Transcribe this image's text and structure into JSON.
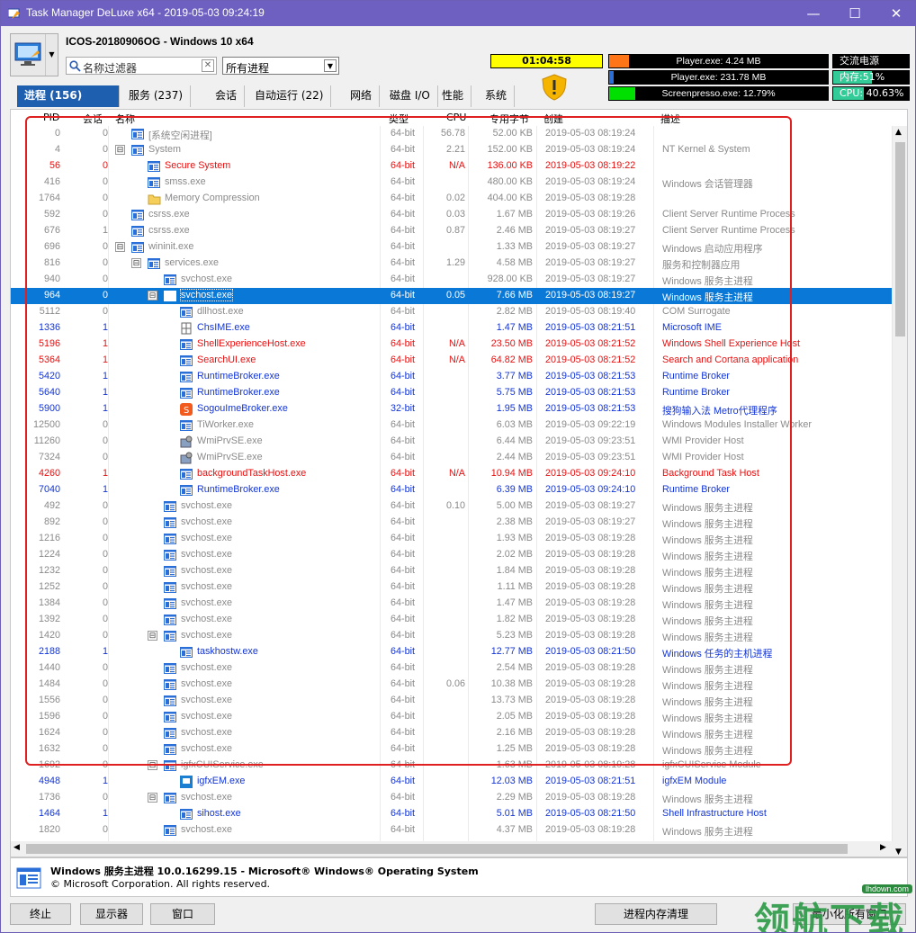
{
  "window": {
    "title": "Task Manager DeLuxe x64 - 2019-05-03 09:24:19"
  },
  "header": {
    "hostname": "ICOS-20180906OG - Windows 10 x64",
    "filter_placeholder": "名称过滤器",
    "process_filter": "所有进程",
    "clock": "01:04:58",
    "bars": [
      {
        "label": "Player.exe: 4.24 MB",
        "fill": 0.09,
        "color": "#ff7518"
      },
      {
        "label": "Player.exe: 231.78 MB",
        "fill": 0.02,
        "color": "#2a6ed8"
      },
      {
        "label": "Screenpresso.exe: 12.79%",
        "fill": 0.12,
        "color": "#00e000"
      }
    ],
    "status": [
      {
        "label": "交流电源",
        "fill": 0
      },
      {
        "label": "内存:51%",
        "fill": 0.51
      },
      {
        "label": "CPU: 40.63%",
        "fill": 0.4
      }
    ]
  },
  "tabs": [
    "进程 (156)",
    "服务 (237)",
    "会话",
    "自动运行 (22)",
    "网络",
    "磁盘 I/O",
    "性能",
    "系统"
  ],
  "columns": {
    "pid": "PID",
    "session": "会话",
    "name": "名称",
    "type": "类型",
    "cpu": "CPU",
    "mem": "专用字节",
    "created": "创建",
    "desc": "描述"
  },
  "rows": [
    {
      "pid": "0",
      "s": "0",
      "d": 1,
      "t": "",
      "n": "[系统空闲进程]",
      "ty": "64-bit",
      "c": "56.78",
      "m": "52.00 KB",
      "cr": "2019-05-03 08:19:24",
      "ds": "",
      "st": "gray",
      "ic": "win"
    },
    {
      "pid": "4",
      "s": "0",
      "d": 1,
      "t": "⊟",
      "n": "System",
      "ty": "64-bit",
      "c": "2.21",
      "m": "152.00 KB",
      "cr": "2019-05-03 08:19:24",
      "ds": "NT Kernel & System",
      "st": "gray",
      "ic": "win"
    },
    {
      "pid": "56",
      "s": "0",
      "d": 2,
      "t": "",
      "n": "Secure System",
      "ty": "64-bit",
      "c": "N/A",
      "m": "136.00 KB",
      "cr": "2019-05-03 08:19:22",
      "ds": "",
      "st": "red",
      "ic": "win"
    },
    {
      "pid": "416",
      "s": "0",
      "d": 2,
      "t": "",
      "n": "smss.exe",
      "ty": "64-bit",
      "c": "",
      "m": "480.00 KB",
      "cr": "2019-05-03 08:19:24",
      "ds": "Windows 会话管理器",
      "st": "gray",
      "ic": "win"
    },
    {
      "pid": "1764",
      "s": "0",
      "d": 2,
      "t": "",
      "n": "Memory Compression",
      "ty": "64-bit",
      "c": "0.02",
      "m": "404.00 KB",
      "cr": "2019-05-03 08:19:28",
      "ds": "",
      "st": "gray",
      "ic": "folder"
    },
    {
      "pid": "592",
      "s": "0",
      "d": 1,
      "t": "",
      "n": "csrss.exe",
      "ty": "64-bit",
      "c": "0.03",
      "m": "1.67 MB",
      "cr": "2019-05-03 08:19:26",
      "ds": "Client Server Runtime Process",
      "st": "gray",
      "ic": "win"
    },
    {
      "pid": "676",
      "s": "1",
      "d": 1,
      "t": "",
      "n": "csrss.exe",
      "ty": "64-bit",
      "c": "0.87",
      "m": "2.46 MB",
      "cr": "2019-05-03 08:19:27",
      "ds": "Client Server Runtime Process",
      "st": "gray",
      "ic": "win"
    },
    {
      "pid": "696",
      "s": "0",
      "d": 1,
      "t": "⊟",
      "n": "wininit.exe",
      "ty": "64-bit",
      "c": "",
      "m": "1.33 MB",
      "cr": "2019-05-03 08:19:27",
      "ds": "Windows 启动应用程序",
      "st": "gray",
      "ic": "win"
    },
    {
      "pid": "816",
      "s": "0",
      "d": 2,
      "t": "⊟",
      "n": "services.exe",
      "ty": "64-bit",
      "c": "1.29",
      "m": "4.58 MB",
      "cr": "2019-05-03 08:19:27",
      "ds": "服务和控制器应用",
      "st": "gray",
      "ic": "win"
    },
    {
      "pid": "940",
      "s": "0",
      "d": 3,
      "t": "",
      "n": "svchost.exe",
      "ty": "64-bit",
      "c": "",
      "m": "928.00 KB",
      "cr": "2019-05-03 08:19:27",
      "ds": "Windows 服务主进程",
      "st": "gray",
      "ic": "win"
    },
    {
      "pid": "964",
      "s": "0",
      "d": 3,
      "t": "⊟",
      "n": "svchost.exe",
      "ty": "64-bit",
      "c": "0.05",
      "m": "7.66 MB",
      "cr": "2019-05-03 08:19:27",
      "ds": "Windows 服务主进程",
      "st": "selrow",
      "ic": "win"
    },
    {
      "pid": "5112",
      "s": "0",
      "d": 4,
      "t": "",
      "n": "dllhost.exe",
      "ty": "64-bit",
      "c": "",
      "m": "2.82 MB",
      "cr": "2019-05-03 08:19:40",
      "ds": "COM Surrogate",
      "st": "gray",
      "ic": "win"
    },
    {
      "pid": "1336",
      "s": "1",
      "d": 4,
      "t": "",
      "n": "ChsIME.exe",
      "ty": "64-bit",
      "c": "",
      "m": "1.47 MB",
      "cr": "2019-05-03 08:21:51",
      "ds": "Microsoft IME",
      "st": "blue",
      "ic": "ime"
    },
    {
      "pid": "5196",
      "s": "1",
      "d": 4,
      "t": "",
      "n": "ShellExperienceHost.exe",
      "ty": "64-bit",
      "c": "N/A",
      "m": "23.50 MB",
      "cr": "2019-05-03 08:21:52",
      "ds": "Windows Shell Experience Host",
      "st": "red",
      "ic": "win"
    },
    {
      "pid": "5364",
      "s": "1",
      "d": 4,
      "t": "",
      "n": "SearchUI.exe",
      "ty": "64-bit",
      "c": "N/A",
      "m": "64.82 MB",
      "cr": "2019-05-03 08:21:52",
      "ds": "Search and Cortana application",
      "st": "red",
      "ic": "win"
    },
    {
      "pid": "5420",
      "s": "1",
      "d": 4,
      "t": "",
      "n": "RuntimeBroker.exe",
      "ty": "64-bit",
      "c": "",
      "m": "3.77 MB",
      "cr": "2019-05-03 08:21:53",
      "ds": "Runtime Broker",
      "st": "blue",
      "ic": "win"
    },
    {
      "pid": "5640",
      "s": "1",
      "d": 4,
      "t": "",
      "n": "RuntimeBroker.exe",
      "ty": "64-bit",
      "c": "",
      "m": "5.75 MB",
      "cr": "2019-05-03 08:21:53",
      "ds": "Runtime Broker",
      "st": "blue",
      "ic": "win"
    },
    {
      "pid": "5900",
      "s": "1",
      "d": 4,
      "t": "",
      "n": "SogouImeBroker.exe",
      "ty": "32-bit",
      "c": "",
      "m": "1.95 MB",
      "cr": "2019-05-03 08:21:53",
      "ds": "搜狗输入法 Metro代理程序",
      "st": "blue",
      "ic": "sogou"
    },
    {
      "pid": "12500",
      "s": "0",
      "d": 4,
      "t": "",
      "n": "TiWorker.exe",
      "ty": "64-bit",
      "c": "",
      "m": "6.03 MB",
      "cr": "2019-05-03 09:22:19",
      "ds": "Windows Modules Installer Worker",
      "st": "gray",
      "ic": "win"
    },
    {
      "pid": "11260",
      "s": "0",
      "d": 4,
      "t": "",
      "n": "WmiPrvSE.exe",
      "ty": "64-bit",
      "c": "",
      "m": "6.44 MB",
      "cr": "2019-05-03 09:23:51",
      "ds": "WMI Provider Host",
      "st": "gray",
      "ic": "wmi"
    },
    {
      "pid": "7324",
      "s": "0",
      "d": 4,
      "t": "",
      "n": "WmiPrvSE.exe",
      "ty": "64-bit",
      "c": "",
      "m": "2.44 MB",
      "cr": "2019-05-03 09:23:51",
      "ds": "WMI Provider Host",
      "st": "gray",
      "ic": "wmi"
    },
    {
      "pid": "4260",
      "s": "1",
      "d": 4,
      "t": "",
      "n": "backgroundTaskHost.exe",
      "ty": "64-bit",
      "c": "N/A",
      "m": "10.94 MB",
      "cr": "2019-05-03 09:24:10",
      "ds": "Background Task Host",
      "st": "red",
      "ic": "win"
    },
    {
      "pid": "7040",
      "s": "1",
      "d": 4,
      "t": "",
      "n": "RuntimeBroker.exe",
      "ty": "64-bit",
      "c": "",
      "m": "6.39 MB",
      "cr": "2019-05-03 09:24:10",
      "ds": "Runtime Broker",
      "st": "blue",
      "ic": "win"
    },
    {
      "pid": "492",
      "s": "0",
      "d": 3,
      "t": "",
      "n": "svchost.exe",
      "ty": "64-bit",
      "c": "0.10",
      "m": "5.00 MB",
      "cr": "2019-05-03 08:19:27",
      "ds": "Windows 服务主进程",
      "st": "gray",
      "ic": "win"
    },
    {
      "pid": "892",
      "s": "0",
      "d": 3,
      "t": "",
      "n": "svchost.exe",
      "ty": "64-bit",
      "c": "",
      "m": "2.38 MB",
      "cr": "2019-05-03 08:19:27",
      "ds": "Windows 服务主进程",
      "st": "gray",
      "ic": "win"
    },
    {
      "pid": "1216",
      "s": "0",
      "d": 3,
      "t": "",
      "n": "svchost.exe",
      "ty": "64-bit",
      "c": "",
      "m": "1.93 MB",
      "cr": "2019-05-03 08:19:28",
      "ds": "Windows 服务主进程",
      "st": "gray",
      "ic": "win"
    },
    {
      "pid": "1224",
      "s": "0",
      "d": 3,
      "t": "",
      "n": "svchost.exe",
      "ty": "64-bit",
      "c": "",
      "m": "2.02 MB",
      "cr": "2019-05-03 08:19:28",
      "ds": "Windows 服务主进程",
      "st": "gray",
      "ic": "win"
    },
    {
      "pid": "1232",
      "s": "0",
      "d": 3,
      "t": "",
      "n": "svchost.exe",
      "ty": "64-bit",
      "c": "",
      "m": "1.84 MB",
      "cr": "2019-05-03 08:19:28",
      "ds": "Windows 服务主进程",
      "st": "gray",
      "ic": "win"
    },
    {
      "pid": "1252",
      "s": "0",
      "d": 3,
      "t": "",
      "n": "svchost.exe",
      "ty": "64-bit",
      "c": "",
      "m": "1.11 MB",
      "cr": "2019-05-03 08:19:28",
      "ds": "Windows 服务主进程",
      "st": "gray",
      "ic": "win"
    },
    {
      "pid": "1384",
      "s": "0",
      "d": 3,
      "t": "",
      "n": "svchost.exe",
      "ty": "64-bit",
      "c": "",
      "m": "1.47 MB",
      "cr": "2019-05-03 08:19:28",
      "ds": "Windows 服务主进程",
      "st": "gray",
      "ic": "win"
    },
    {
      "pid": "1392",
      "s": "0",
      "d": 3,
      "t": "",
      "n": "svchost.exe",
      "ty": "64-bit",
      "c": "",
      "m": "1.82 MB",
      "cr": "2019-05-03 08:19:28",
      "ds": "Windows 服务主进程",
      "st": "gray",
      "ic": "win"
    },
    {
      "pid": "1420",
      "s": "0",
      "d": 3,
      "t": "⊟",
      "n": "svchost.exe",
      "ty": "64-bit",
      "c": "",
      "m": "5.23 MB",
      "cr": "2019-05-03 08:19:28",
      "ds": "Windows 服务主进程",
      "st": "gray",
      "ic": "win"
    },
    {
      "pid": "2188",
      "s": "1",
      "d": 4,
      "t": "",
      "n": "taskhostw.exe",
      "ty": "64-bit",
      "c": "",
      "m": "12.77 MB",
      "cr": "2019-05-03 08:21:50",
      "ds": "Windows 任务的主机进程",
      "st": "blue",
      "ic": "win"
    },
    {
      "pid": "1440",
      "s": "0",
      "d": 3,
      "t": "",
      "n": "svchost.exe",
      "ty": "64-bit",
      "c": "",
      "m": "2.54 MB",
      "cr": "2019-05-03 08:19:28",
      "ds": "Windows 服务主进程",
      "st": "gray",
      "ic": "win"
    },
    {
      "pid": "1484",
      "s": "0",
      "d": 3,
      "t": "",
      "n": "svchost.exe",
      "ty": "64-bit",
      "c": "0.06",
      "m": "10.38 MB",
      "cr": "2019-05-03 08:19:28",
      "ds": "Windows 服务主进程",
      "st": "gray",
      "ic": "win"
    },
    {
      "pid": "1556",
      "s": "0",
      "d": 3,
      "t": "",
      "n": "svchost.exe",
      "ty": "64-bit",
      "c": "",
      "m": "13.73 MB",
      "cr": "2019-05-03 08:19:28",
      "ds": "Windows 服务主进程",
      "st": "gray",
      "ic": "win"
    },
    {
      "pid": "1596",
      "s": "0",
      "d": 3,
      "t": "",
      "n": "svchost.exe",
      "ty": "64-bit",
      "c": "",
      "m": "2.05 MB",
      "cr": "2019-05-03 08:19:28",
      "ds": "Windows 服务主进程",
      "st": "gray",
      "ic": "win"
    },
    {
      "pid": "1624",
      "s": "0",
      "d": 3,
      "t": "",
      "n": "svchost.exe",
      "ty": "64-bit",
      "c": "",
      "m": "2.16 MB",
      "cr": "2019-05-03 08:19:28",
      "ds": "Windows 服务主进程",
      "st": "gray",
      "ic": "win"
    },
    {
      "pid": "1632",
      "s": "0",
      "d": 3,
      "t": "",
      "n": "svchost.exe",
      "ty": "64-bit",
      "c": "",
      "m": "1.25 MB",
      "cr": "2019-05-03 08:19:28",
      "ds": "Windows 服务主进程",
      "st": "gray",
      "ic": "win"
    },
    {
      "pid": "1692",
      "s": "0",
      "d": 3,
      "t": "⊟",
      "n": "igfxCUIService.exe",
      "ty": "64-bit",
      "c": "",
      "m": "1.63 MB",
      "cr": "2019-05-03 08:19:28",
      "ds": "igfxCUIService Module",
      "st": "gray",
      "ic": "win"
    },
    {
      "pid": "4948",
      "s": "1",
      "d": 4,
      "t": "",
      "n": "igfxEM.exe",
      "ty": "64-bit",
      "c": "",
      "m": "12.03 MB",
      "cr": "2019-05-03 08:21:51",
      "ds": "igfxEM Module",
      "st": "blue",
      "ic": "igfx"
    },
    {
      "pid": "1736",
      "s": "0",
      "d": 3,
      "t": "⊟",
      "n": "svchost.exe",
      "ty": "64-bit",
      "c": "",
      "m": "2.29 MB",
      "cr": "2019-05-03 08:19:28",
      "ds": "Windows 服务主进程",
      "st": "gray",
      "ic": "win"
    },
    {
      "pid": "1464",
      "s": "1",
      "d": 4,
      "t": "",
      "n": "sihost.exe",
      "ty": "64-bit",
      "c": "",
      "m": "5.01 MB",
      "cr": "2019-05-03 08:21:50",
      "ds": "Shell Infrastructure Host",
      "st": "blue",
      "ic": "win"
    },
    {
      "pid": "1820",
      "s": "0",
      "d": 3,
      "t": "",
      "n": "svchost.exe",
      "ty": "64-bit",
      "c": "",
      "m": "4.37 MB",
      "cr": "2019-05-03 08:19:28",
      "ds": "Windows 服务主进程",
      "st": "gray",
      "ic": "win"
    }
  ],
  "info": {
    "line1": "Windows 服务主进程 10.0.16299.15 - Microsoft® Windows® Operating System",
    "line2": "© Microsoft Corporation. All rights reserved."
  },
  "buttons": {
    "end": "终止",
    "show": "显示器",
    "window": "窗口",
    "clean": "进程内存清理",
    "minimize_all": "最小化所有窗口"
  },
  "watermark": {
    "text": "领航下载",
    "url": "lhdown.com"
  }
}
